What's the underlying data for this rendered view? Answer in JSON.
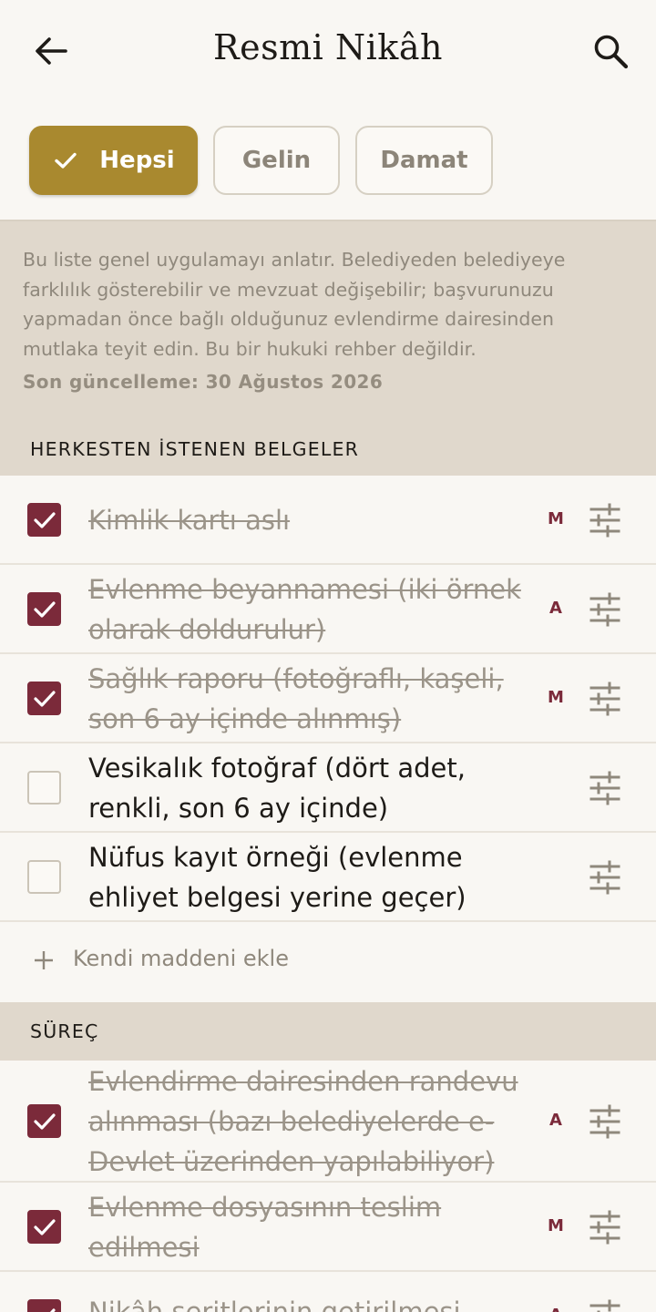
{
  "header": {
    "title": "Resmi Nikâh",
    "back_icon": "arrow-left-icon",
    "search_icon": "search-icon"
  },
  "filters": [
    {
      "label": "Hepsi",
      "selected": true
    },
    {
      "label": "Gelin",
      "selected": false
    },
    {
      "label": "Damat",
      "selected": false
    }
  ],
  "disclaimer": {
    "text": "Bu liste genel uygulamayı anlatır. Belediyeden belediyeye farklılık gösterebilir ve mevzuat değişebilir; başvurunuzu yapmadan önce bağlı olduğunuz evlendirme dairesinden mutlaka teyit edin. Bu bir hukuki rehber değildir.",
    "updated": "Son güncelleme: 30 Ağustos 2026"
  },
  "sections": [
    {
      "title": "HERKESTEN İSTENEN BELGELER",
      "items": [
        {
          "label": "Kimlik kartı aslı",
          "checked": true,
          "who": "M"
        },
        {
          "label": "Evlenme beyannamesi (iki örnek olarak doldurulur)",
          "checked": true,
          "who": "A"
        },
        {
          "label": "Sağlık raporu (fotoğraflı, kaşeli, son 6 ay içinde alınmış)",
          "checked": true,
          "who": "M"
        },
        {
          "label": "Vesikalık fotoğraf (dört adet, renkli, son 6 ay içinde)",
          "checked": false,
          "who": ""
        },
        {
          "label": "Nüfus kayıt örneği (evlenme ehliyet belgesi yerine geçer)",
          "checked": false,
          "who": ""
        }
      ],
      "add_label": "Kendi maddeni ekle"
    },
    {
      "title": "SÜREÇ",
      "items": [
        {
          "label": "Evlendirme dairesinden randevu alınması (bazı belediyelerde e-Devlet üzerinden yapılabiliyor)",
          "checked": true,
          "who": "A"
        },
        {
          "label": "Evlenme dosyasının teslim edilmesi",
          "checked": true,
          "who": "M"
        },
        {
          "label": "Nikâh şeritlerinin getirilmesi",
          "checked": true,
          "who": "A"
        }
      ]
    }
  ],
  "colors": {
    "accent_gold": "#a9892f",
    "checkbox_burgundy": "#7b2a3a",
    "band_beige": "#e0d8cc",
    "page_bg": "#f9f7f3"
  }
}
